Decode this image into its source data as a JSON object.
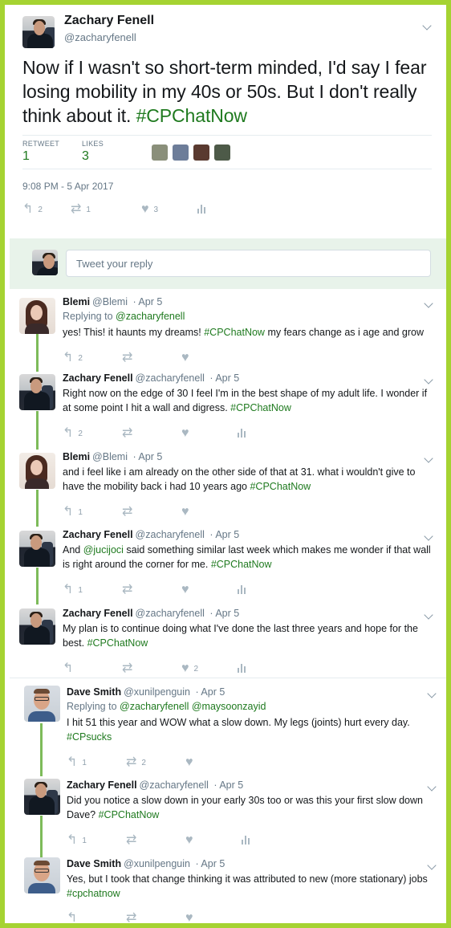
{
  "main": {
    "name": "Zachary Fenell",
    "handle": "@zacharyfenell",
    "text_before": "Now if I wasn't so short-term minded, I'd say I fear losing mobility in my 40s or 50s. But I don't really think about it. ",
    "hashtag": "#CPChatNow",
    "retweets_label": "RETWEET",
    "retweets": "1",
    "likes_label": "LIKES",
    "likes": "3",
    "timestamp": "9:08 PM - 5 Apr 2017",
    "reply_count": "2",
    "retweet_count": "1",
    "like_count": "3"
  },
  "reply_box": {
    "placeholder": "Tweet your reply"
  },
  "thread": [
    {
      "name": "Blemi",
      "handle": "@Blemi",
      "time": "· Apr 5",
      "replying_prefix": "Replying to ",
      "replying_to": "@zacharyfenell",
      "text_before": "yes! This! it haunts my dreams! ",
      "tag": "#CPChatNow",
      "text_after": " my fears change as i age and grow",
      "reply": "2",
      "retweet": "",
      "like": ""
    },
    {
      "name": "Zachary Fenell",
      "handle": "@zacharyfenell",
      "time": "· Apr 5",
      "text_before": "Right now on the edge of 30 I feel I'm in the best shape of my adult life. I wonder if at some point I hit a wall and digress. ",
      "tag": "#CPChatNow",
      "text_after": "",
      "reply": "2",
      "retweet": "",
      "like": ""
    },
    {
      "name": "Blemi",
      "handle": "@Blemi",
      "time": "· Apr 5",
      "text_before": "and i feel like i am already on the other side of that at 31. what i wouldn't give to have the mobility back i had 10 years ago ",
      "tag": "#CPChatNow",
      "text_after": "",
      "reply": "1",
      "retweet": "",
      "like": ""
    },
    {
      "name": "Zachary Fenell",
      "handle": "@zacharyfenell",
      "time": "· Apr 5",
      "text_before": "And ",
      "mention": "@jucijoci",
      "text_mid": " said something similar last week which makes me wonder if that wall is right around the corner for me. ",
      "tag": "#CPChatNow",
      "reply": "1",
      "retweet": "",
      "like": ""
    },
    {
      "name": "Zachary Fenell",
      "handle": "@zacharyfenell",
      "time": "· Apr 5",
      "text_before": "My plan is to continue doing what I've done the last three years and hope for the best. ",
      "tag": "#CPChatNow",
      "text_after": "",
      "reply": "",
      "retweet": "",
      "like": "2"
    },
    {
      "name": "Dave Smith",
      "handle": "@xunilpenguin",
      "time": "· Apr 5",
      "replying_prefix": "Replying to ",
      "replying_to": "@zacharyfenell",
      "replying_to_2": "@maysoonzayid",
      "text_before": "I hit 51 this year and WOW what a slow down. My legs (joints) hurt every day. ",
      "tag": "#CPsucks",
      "text_after": "",
      "reply": "1",
      "retweet": "2",
      "like": ""
    },
    {
      "name": "Zachary Fenell",
      "handle": "@zacharyfenell",
      "time": "· Apr 5",
      "text_before": "Did you notice a slow down in your early 30s too or was this your first slow down Dave? ",
      "tag": "#CPChatNow",
      "text_after": "",
      "reply": "1",
      "retweet": "",
      "like": ""
    },
    {
      "name": "Dave Smith",
      "handle": "@xunilpenguin",
      "time": "· Apr 5",
      "text_before": "Yes, but I took that change thinking it was attributed to new (more stationary) jobs ",
      "tag": "#cpchatnow",
      "text_after": "",
      "reply": "",
      "retweet": "",
      "like": ""
    }
  ],
  "icons": {
    "reply": "reply-icon",
    "retweet": "retweet-icon",
    "like": "heart-icon",
    "analytics": "analytics-icon",
    "more": "chevron-down-icon"
  },
  "colors": {
    "frame": "#a5d332",
    "hashtag": "#1f7a1f",
    "thread_line": "#7dbb5a",
    "reply_bg": "#e8f3ea"
  }
}
